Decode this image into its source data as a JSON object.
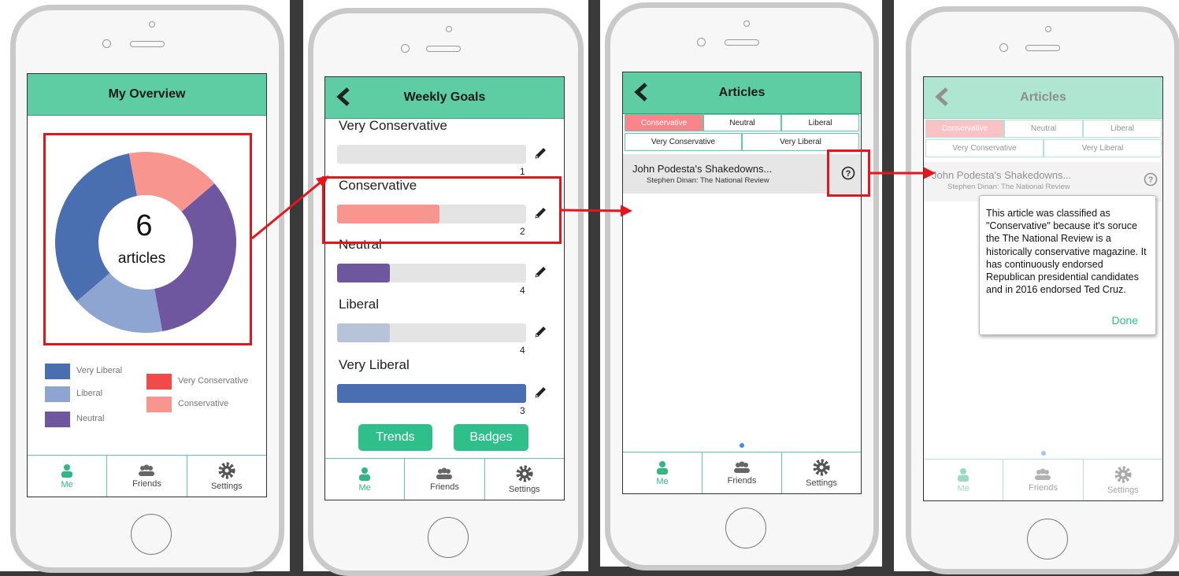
{
  "screens": {
    "overview": {
      "title": "My Overview",
      "count": "6",
      "count_label": "articles",
      "legend": [
        {
          "label": "Very Liberal",
          "color": "#4a6fb0"
        },
        {
          "label": "Liberal",
          "color": "#8ea4d1"
        },
        {
          "label": "Neutral",
          "color": "#6f57a0"
        },
        {
          "label": "Very Conservative",
          "color": "#f14a48"
        },
        {
          "label": "Conservative",
          "color": "#f9958f"
        }
      ]
    },
    "goals": {
      "title": "Weekly Goals",
      "items": [
        {
          "label": "Very Conservative",
          "goal": "1",
          "progress": 0.0,
          "color": "#e4e4e4"
        },
        {
          "label": "Conservative",
          "goal": "2",
          "progress": 0.54,
          "color": "#f9958f"
        },
        {
          "label": "Neutral",
          "goal": "4",
          "progress": 0.28,
          "color": "#6f57a0"
        },
        {
          "label": "Liberal",
          "goal": "4",
          "progress": 0.28,
          "color": "#b6c3d8"
        },
        {
          "label": "Very Liberal",
          "goal": "3",
          "progress": 1.0,
          "color": "#4a6fb0"
        }
      ],
      "trends_label": "Trends",
      "badges_label": "Badges"
    },
    "articles": {
      "title": "Articles",
      "filters_row1": [
        "Conservative",
        "Neutral",
        "Liberal"
      ],
      "filters_row2": [
        "Very Conservative",
        "Very Liberal"
      ],
      "article_title": "John Podesta's Shakedowns...",
      "article_source": "Stephen Dinan: The National Review"
    },
    "popup": {
      "title": "Articles",
      "filters_row1": [
        "Conservative",
        "Neutral",
        "Liberal"
      ],
      "filters_row2": [
        "Very Conservative",
        "Very Liberal"
      ],
      "article_title": "John Podesta's Shakedowns...",
      "article_source": "Stephen Dinan: The National Review",
      "tooltip": "This article was classified as \"Conservative\" because it's soruce the The National Review is a historically conservative magazine. It has continuously endorsed Republican presidential candidates and in 2016 endorsed Ted Cruz.",
      "done_label": "Done"
    }
  },
  "tabs": [
    {
      "label": "Me",
      "icon": "person-icon"
    },
    {
      "label": "Friends",
      "icon": "friends-icon"
    },
    {
      "label": "Settings",
      "icon": "gear-icon"
    }
  ],
  "chart_data": {
    "type": "pie",
    "categories": [
      "Very Liberal",
      "Conservative",
      "Neutral",
      "Liberal"
    ],
    "values": [
      2,
      1,
      2,
      1
    ]
  },
  "colors": {
    "accent": "#5ecda4",
    "button": "#2fbf8a",
    "highlight": "#e8141b"
  }
}
